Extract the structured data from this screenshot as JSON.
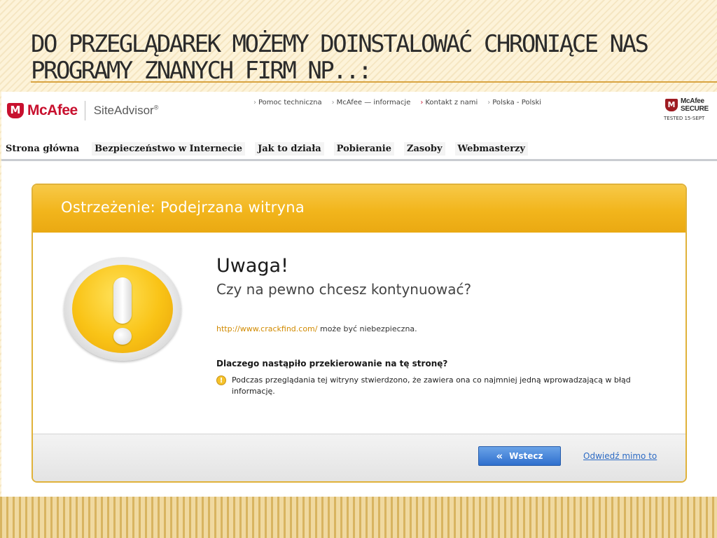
{
  "slide": {
    "title": "Do przeglądarek możemy doinstalować chroniące nas programy znanych firm np..:"
  },
  "header": {
    "brand_name": "McAfee",
    "brand_mark": "M",
    "product_name": "SiteAdvisor",
    "product_mark": "®",
    "top_links": [
      {
        "label": "Pomoc techniczna",
        "icon": "chevron-right-icon"
      },
      {
        "label": "McAfee — informacje",
        "icon": "chevron-right-icon"
      },
      {
        "label": "Kontakt z nami",
        "icon": "chevron-right-icon"
      },
      {
        "label": "Polska - Polski",
        "icon": "chevron-right-icon"
      }
    ],
    "secure_badge": {
      "line1": "McAfee",
      "line2": "SECURE",
      "tested": "TESTED 15-SEPT"
    }
  },
  "nav": {
    "items": [
      "Strona główna",
      "Bezpieczeństwo w Internecie",
      "Jak to działa",
      "Pobieranie",
      "Zasoby",
      "Webmasterzy"
    ]
  },
  "warning": {
    "banner_title": "Ostrzeżenie: Podejrzana witryna",
    "heading": "Uwaga!",
    "subheading": "Czy na pewno chcesz kontynuować?",
    "url": "http://www.crackfind.com/",
    "url_suffix": " może być niebezpieczna.",
    "why_heading": "Dlaczego nastąpiło przekierowanie na tę stronę?",
    "reason": "Podczas przeglądania tej witryny stwierdzono, że zawiera ona co najmniej jedną wprowadzającą w błąd informację."
  },
  "actions": {
    "back_label": "Wstecz",
    "visit_label": "Odwiedź mimo to"
  },
  "colors": {
    "brand_red": "#c8102e",
    "warning_yellow": "#f2b51c",
    "button_blue": "#2f6fcd",
    "link_orange": "#d18a00"
  }
}
